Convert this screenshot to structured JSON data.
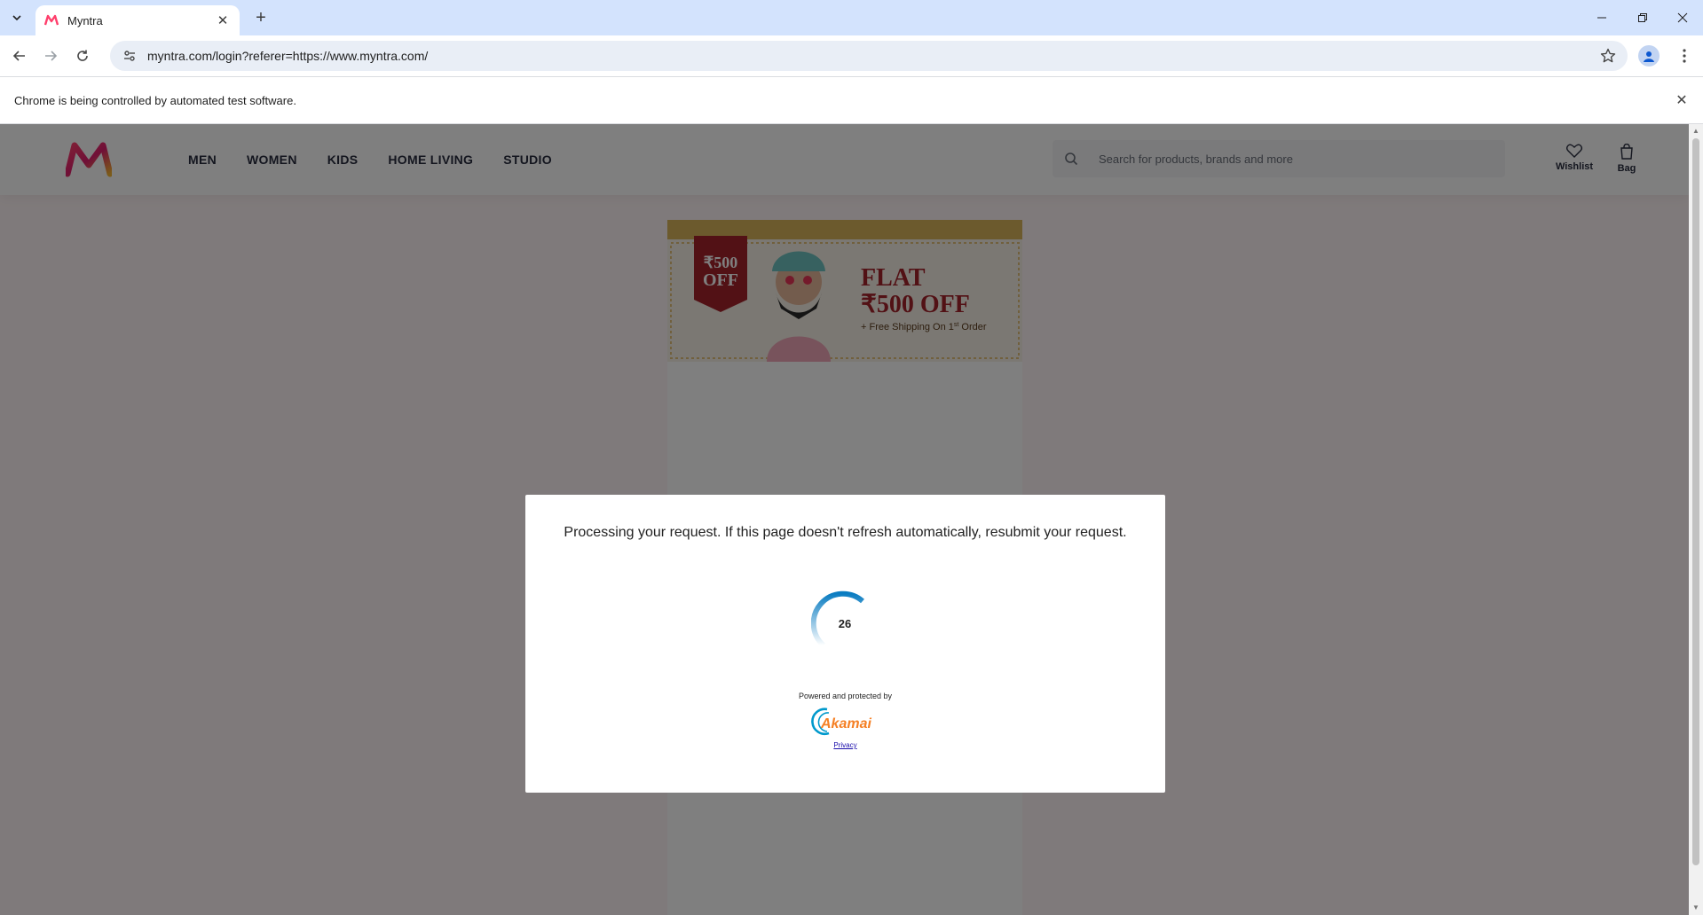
{
  "browser": {
    "tab": {
      "title": "Myntra"
    },
    "url": "myntra.com/login?referer=https://www.myntra.com/",
    "infobar": {
      "message": "Chrome is being controlled by automated test software."
    }
  },
  "site": {
    "nav": [
      "MEN",
      "WOMEN",
      "KIDS",
      "HOME LIVING",
      "STUDIO"
    ],
    "search_placeholder": "Search for products, brands and more",
    "wishlist_label": "Wishlist",
    "bag_label": "Bag",
    "banner": {
      "badge_line1": "₹500",
      "badge_line2": "OFF",
      "headline1": "FLAT",
      "headline2": "₹500 OFF",
      "subline_prefix": "+ Free Shipping On 1",
      "subline_sup": "st",
      "subline_suffix": " Order"
    }
  },
  "dialog": {
    "message": "Processing your request. If this page doesn't refresh automatically, resubmit your request.",
    "countdown": "26",
    "powered_by": "Powered and protected by",
    "brand": "Akamai",
    "privacy_link": "Privacy"
  },
  "colors": {
    "tabstrip": "#d3e3fd",
    "akamai_blue": "#0099cc",
    "akamai_orange": "#f58025",
    "spinner_blue": "#0a7cc1",
    "myntra_pink": "#ff3f6c",
    "banner_red": "#a5232b"
  }
}
